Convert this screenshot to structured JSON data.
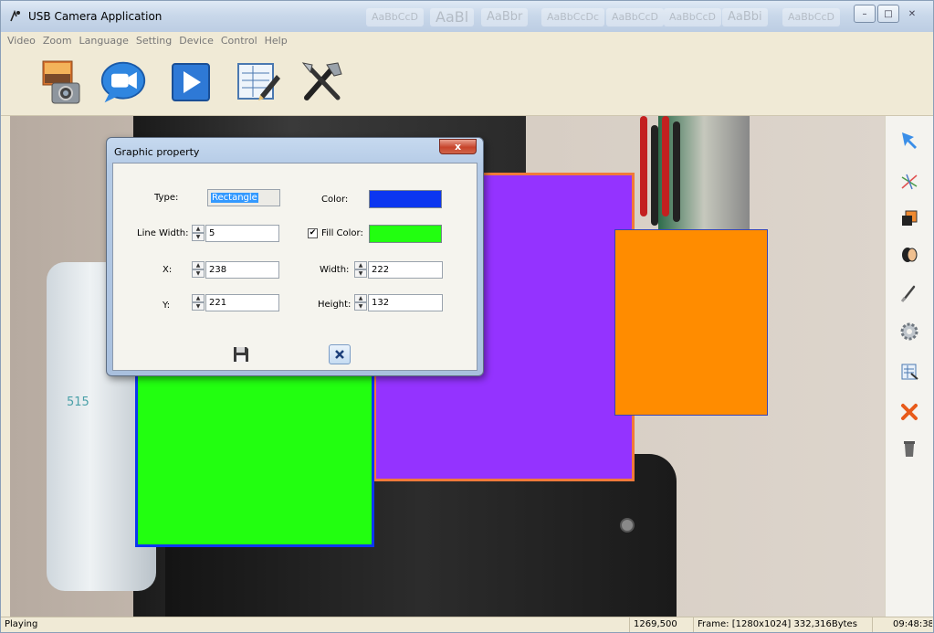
{
  "window": {
    "title": "USB Camera Application",
    "ghost_tabs": [
      "AaBbCcD",
      "AaBl",
      "AaBbr",
      "AaBbCcDc",
      "AaBbCcD",
      "AaBbCcD",
      "AaBbCcD",
      "AaBbi",
      "AaBbCcD"
    ],
    "minimize": "–",
    "maximize": "□",
    "close": "✕"
  },
  "menu": [
    "Video",
    "Zoom",
    "Language",
    "Setting",
    "Device",
    "Control",
    "Help"
  ],
  "toolbar": {
    "icons": [
      "snapshot-camera-icon",
      "video-record-icon",
      "play-icon",
      "draw-edit-icon",
      "tools-icon"
    ]
  },
  "view": {
    "motor_label": "515"
  },
  "sidebar": {
    "icons": [
      "select-arrow-icon",
      "line-draw-icon",
      "shape-rect-icon",
      "ellipse-icon",
      "brush-icon",
      "settings-gear-icon",
      "properties-icon",
      "delete-x-icon",
      "trash-icon"
    ]
  },
  "dialog": {
    "title": "Graphic property",
    "close": "x",
    "type_label": "Type:",
    "type_value": "Rectangle",
    "color_label": "Color:",
    "line_width_label": "Line Width:",
    "line_width_value": "5",
    "fill_color_label": "Fill Color:",
    "fill_checked": "✔",
    "x_label": "X:",
    "x_value": "238",
    "width_label": "Width:",
    "width_value": "222",
    "y_label": "Y:",
    "y_value": "221",
    "height_label": "Height:",
    "height_value": "132",
    "colors": {
      "stroke": "#0c36f0",
      "fill": "#22ff10"
    }
  },
  "status": {
    "state": "Playing",
    "coords": "1269,500",
    "frame": "Frame: [1280x1024] 332,316Bytes",
    "time": "09:48:38"
  },
  "shape_colors": {
    "purple_fill": "#9433ff",
    "purple_stroke": "#f07a3a",
    "green_fill": "#22ff10",
    "green_stroke": "#0c36f0",
    "orange_fill": "#ff8c00"
  }
}
